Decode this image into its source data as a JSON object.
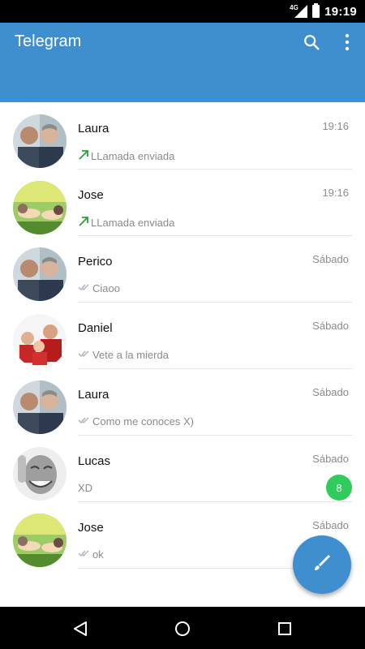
{
  "status_bar": {
    "time": "19:19",
    "network": "4G",
    "icons": [
      "signal-icon",
      "battery-icon"
    ]
  },
  "app": {
    "title": "Telegram",
    "accent": "#3f8fd0"
  },
  "toolbar": {
    "icons": [
      "search-icon",
      "more-vert-icon"
    ]
  },
  "chats": [
    {
      "name": "Laura",
      "time": "19:16",
      "preview": "LLamada enviada",
      "status": "call-outgoing",
      "avatar": "two-men"
    },
    {
      "name": "Jose",
      "time": "19:16",
      "preview": "LLamada enviada",
      "status": "call-outgoing",
      "avatar": "grass"
    },
    {
      "name": "Perico",
      "time": "Sábado",
      "preview": "Ciaoo",
      "status": "read",
      "avatar": "two-men"
    },
    {
      "name": "Daniel",
      "time": "Sábado",
      "preview": "Vete a la mierda",
      "status": "read",
      "avatar": "family"
    },
    {
      "name": "Laura",
      "time": "Sábado",
      "preview": "Como me conoces X)",
      "status": "read",
      "avatar": "two-men"
    },
    {
      "name": "Lucas",
      "time": "Sábado",
      "preview": "XD",
      "status": "none",
      "unread": "8",
      "avatar": "laughing-man"
    },
    {
      "name": "Jose",
      "time": "Sábado",
      "preview": "ok",
      "status": "read",
      "avatar": "grass"
    }
  ],
  "fab": {
    "icon": "pencil-icon"
  },
  "nav": {
    "icons": [
      "back-icon",
      "home-icon",
      "recents-icon"
    ]
  },
  "colors": {
    "unread_badge": "#2fcc5b",
    "call_arrow": "#2e9d3b",
    "read_check": "#aab4bd"
  }
}
